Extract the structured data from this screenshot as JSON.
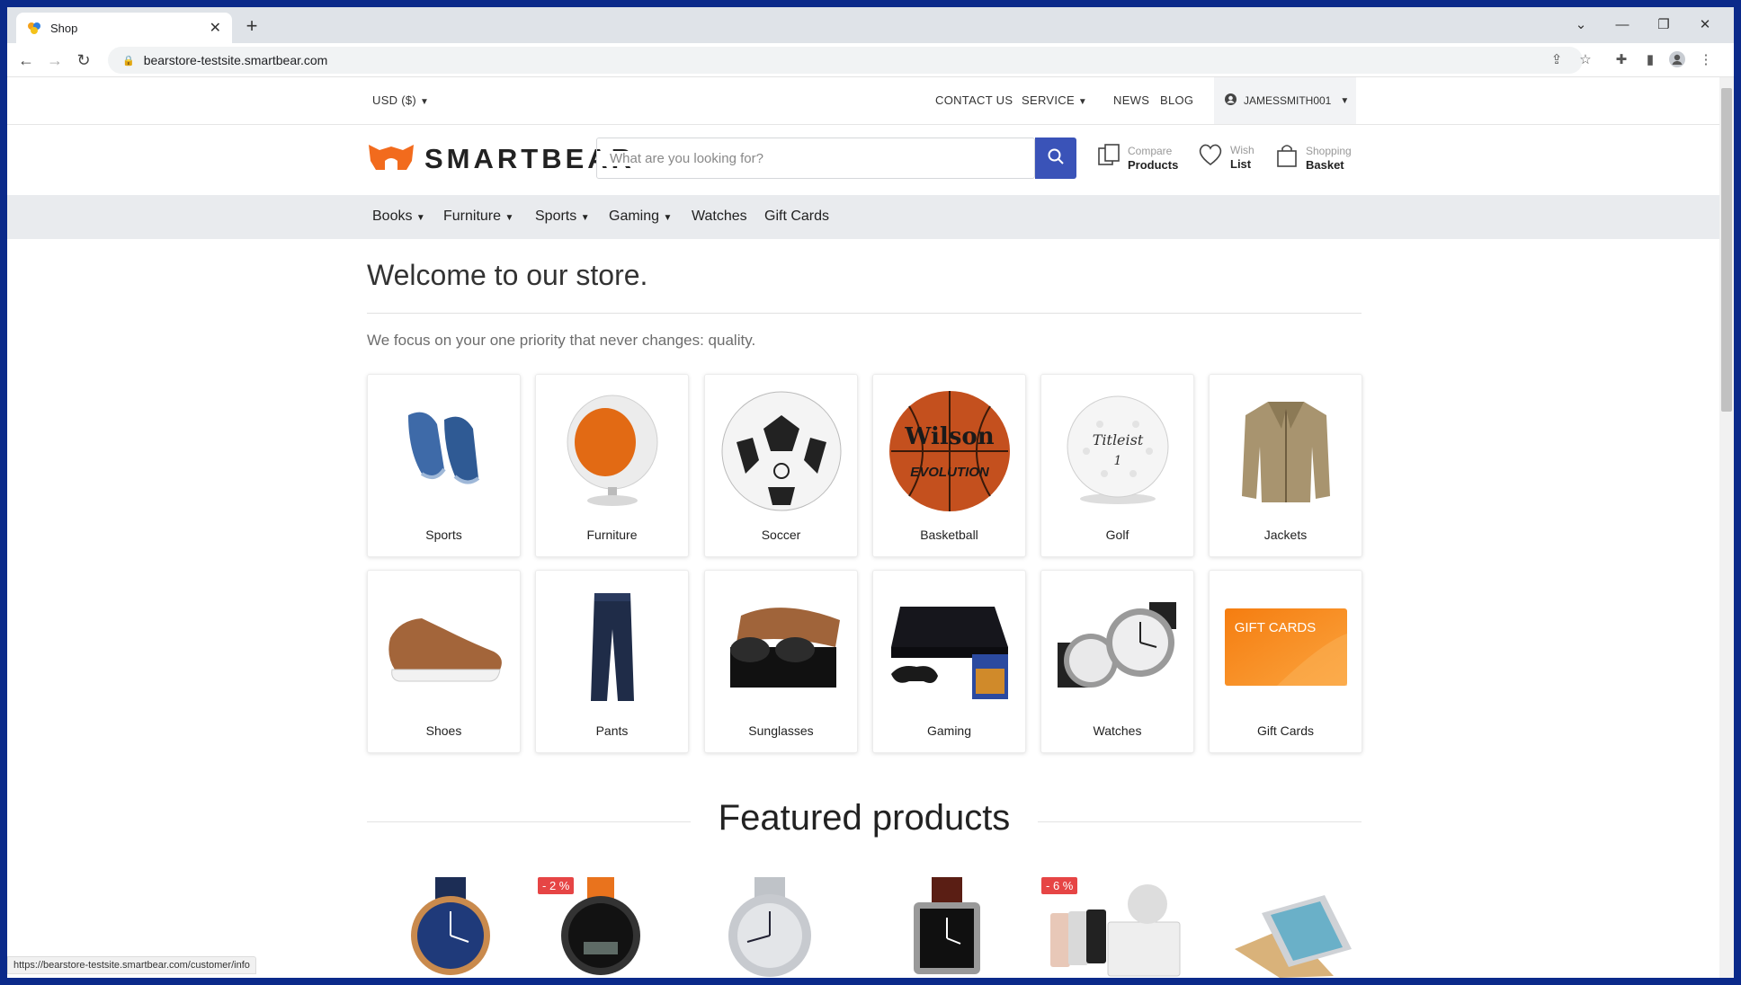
{
  "browser": {
    "tab_title": "Shop",
    "url": "bearstore-testsite.smartbear.com",
    "status_url": "https://bearstore-testsite.smartbear.com/customer/info"
  },
  "topbar": {
    "currency": "USD  ($)",
    "contact": "CONTACT US",
    "service": "SERVICE",
    "news": "NEWS",
    "blog": "BLOG",
    "account": "JAMESSMITH001"
  },
  "header": {
    "logo_text": "SMARTBEAR",
    "search_placeholder": "What are you looking for?",
    "compare_l1": "Compare",
    "compare_l2": "Products",
    "wish_l1": "Wish",
    "wish_l2": "List",
    "basket_l1": "Shopping",
    "basket_l2": "Basket"
  },
  "menu": [
    "Books",
    "Furniture",
    "Sports",
    "Gaming",
    "Watches",
    "Gift Cards"
  ],
  "main": {
    "welcome": "Welcome to our store.",
    "tagline": "We focus on your one priority that never changes: quality.",
    "featured_title": "Featured products"
  },
  "categories": [
    "Sports",
    "Furniture",
    "Soccer",
    "Basketball",
    "Golf",
    "Jackets",
    "Shoes",
    "Pants",
    "Sunglasses",
    "Gaming",
    "Watches",
    "Gift Cards"
  ],
  "category_art": {
    "basketball_brand": "Wilson",
    "basketball_model": "EVOLUTION",
    "golf_brand": "Titleist",
    "golf_number": "1",
    "giftcard_text": "GIFT CARDS"
  },
  "products": {
    "badges": [
      "- 2 %",
      "- 6 %"
    ]
  },
  "colors": {
    "accent_blue": "#3a53b8",
    "logo_orange": "#f26b1d",
    "menu_bg": "#e9ebee",
    "badge_red": "#e64545"
  }
}
